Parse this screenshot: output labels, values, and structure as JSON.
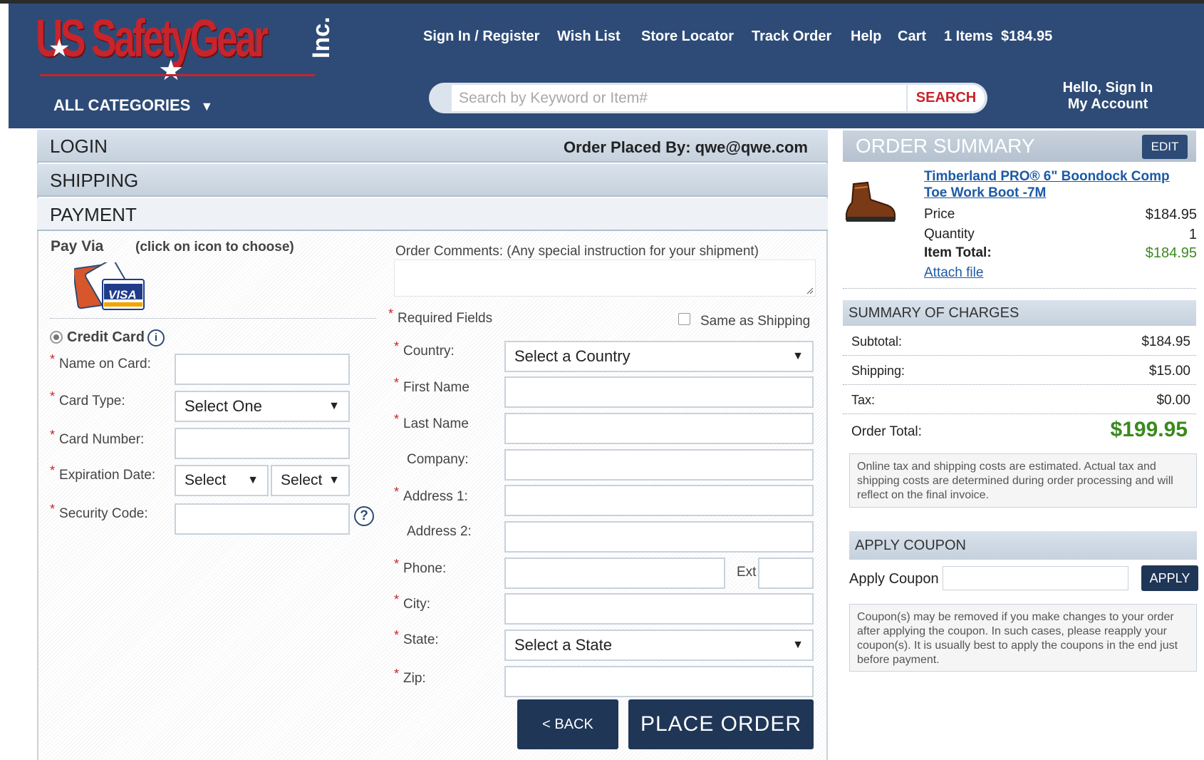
{
  "header": {
    "brand": "US SafetyGear",
    "brand_suffix": "Inc.",
    "links": [
      "Sign In / Register",
      "Wish List",
      "Store Locator",
      "Track Order",
      "Help",
      "Cart"
    ],
    "cart_items": "1 Items",
    "cart_total": "$184.95",
    "categories_label": "ALL CATEGORIES",
    "search_placeholder": "Search by Keyword or Item#",
    "search_button": "SEARCH",
    "hello": "Hello, Sign In",
    "my_account": "My Account"
  },
  "steps": {
    "login": "LOGIN",
    "order_placed_by": "Order Placed By: qwe@qwe.com",
    "shipping": "SHIPPING",
    "payment": "PAYMENT"
  },
  "payment": {
    "pay_via": "Pay Via",
    "pay_via_hint": "(click on icon to choose)",
    "card_logo_text": "VISA",
    "credit_card_label": "Credit Card",
    "fields": {
      "name_on_card": "Name on Card:",
      "card_type": "Card Type:",
      "card_type_value": "Select One",
      "card_number": "Card Number:",
      "expiration": "Expiration Date:",
      "exp_month": "Select",
      "exp_year": "Select",
      "security_code": "Security Code:"
    }
  },
  "billing": {
    "comments_label": "Order Comments: (Any special instruction for your shipment)",
    "required_fields": "Required Fields",
    "same_as_shipping": "Same as Shipping",
    "country": "Country:",
    "country_value": "Select a Country",
    "first_name": "First Name",
    "last_name": "Last Name",
    "company": "Company:",
    "address1": "Address 1:",
    "address2": "Address 2:",
    "phone": "Phone:",
    "ext": "Ext",
    "city": "City:",
    "state": "State:",
    "state_value": "Select a State",
    "zip": "Zip:",
    "back_button": "< BACK",
    "place_order_button": "PLACE ORDER"
  },
  "summary": {
    "title": "ORDER SUMMARY",
    "edit": "EDIT",
    "product_name": "Timberland PRO® 6\" Boondock Comp Toe Work Boot -7M",
    "price_label": "Price",
    "price": "$184.95",
    "quantity_label": "Quantity",
    "quantity": "1",
    "item_total_label": "Item Total:",
    "item_total": "$184.95",
    "attach_file": "Attach file",
    "charges_title": "SUMMARY OF CHARGES",
    "subtotal_label": "Subtotal:",
    "subtotal": "$184.95",
    "shipping_label": "Shipping:",
    "shipping": "$15.00",
    "tax_label": "Tax:",
    "tax": "$0.00",
    "order_total_label": "Order Total:",
    "order_total": "$199.95",
    "tax_note": "Online tax and shipping costs are estimated. Actual tax and shipping costs are determined during order processing and will reflect on the final invoice.",
    "coupon_title": "APPLY COUPON",
    "coupon_label": "Apply Coupon",
    "apply_button": "APPLY",
    "coupon_note": "Coupon(s) may be removed if you make changes to your order after applying the coupon. In such cases, please reapply your coupon(s). It is usually best to apply the coupons in the end just before payment."
  },
  "colors": {
    "header_bg": "#2d4b76",
    "brand_red": "#c8242b",
    "link_blue": "#1c5aa6",
    "total_green": "#3a8a1e",
    "button_navy": "#1f3657"
  }
}
